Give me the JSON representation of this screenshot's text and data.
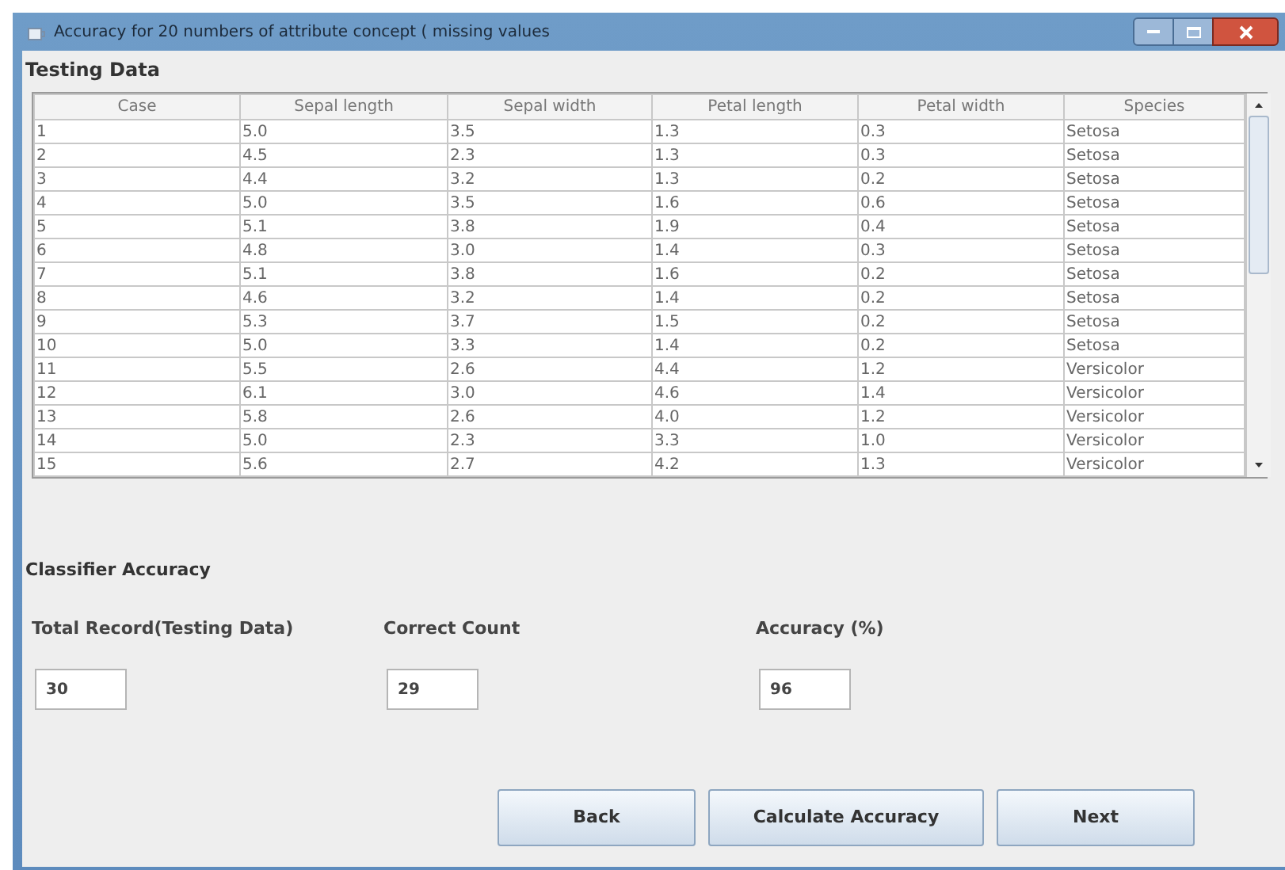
{
  "window": {
    "title": "Accuracy for 20 numbers of attribute concept ( missing values"
  },
  "testing_data": {
    "title": "Testing Data",
    "columns": [
      "Case",
      "Sepal length",
      "Sepal width",
      "Petal length",
      "Petal width",
      "Species"
    ],
    "rows": [
      [
        "1",
        "5.0",
        "3.5",
        "1.3",
        "0.3",
        "Setosa"
      ],
      [
        "2",
        "4.5",
        "2.3",
        "1.3",
        "0.3",
        "Setosa"
      ],
      [
        "3",
        "4.4",
        "3.2",
        "1.3",
        "0.2",
        "Setosa"
      ],
      [
        "4",
        "5.0",
        "3.5",
        "1.6",
        "0.6",
        "Setosa"
      ],
      [
        "5",
        "5.1",
        "3.8",
        "1.9",
        "0.4",
        "Setosa"
      ],
      [
        "6",
        "4.8",
        "3.0",
        "1.4",
        "0.3",
        "Setosa"
      ],
      [
        "7",
        "5.1",
        "3.8",
        "1.6",
        "0.2",
        "Setosa"
      ],
      [
        "8",
        "4.6",
        "3.2",
        "1.4",
        "0.2",
        "Setosa"
      ],
      [
        "9",
        "5.3",
        "3.7",
        "1.5",
        "0.2",
        "Setosa"
      ],
      [
        "10",
        "5.0",
        "3.3",
        "1.4",
        "0.2",
        "Setosa"
      ],
      [
        "11",
        "5.5",
        "2.6",
        "4.4",
        "1.2",
        "Versicolor"
      ],
      [
        "12",
        "6.1",
        "3.0",
        "4.6",
        "1.4",
        "Versicolor"
      ],
      [
        "13",
        "5.8",
        "2.6",
        "4.0",
        "1.2",
        "Versicolor"
      ],
      [
        "14",
        "5.0",
        "2.3",
        "3.3",
        "1.0",
        "Versicolor"
      ],
      [
        "15",
        "5.6",
        "2.7",
        "4.2",
        "1.3",
        "Versicolor"
      ]
    ]
  },
  "classifier_accuracy": {
    "title": "Classifier Accuracy",
    "fields": [
      {
        "label": "Total Record(Testing Data)",
        "value": "30"
      },
      {
        "label": "Correct Count",
        "value": "29"
      },
      {
        "label": "Accuracy (%)",
        "value": "96"
      }
    ]
  },
  "buttons": [
    "Back",
    "Calculate Accuracy",
    "Next"
  ]
}
